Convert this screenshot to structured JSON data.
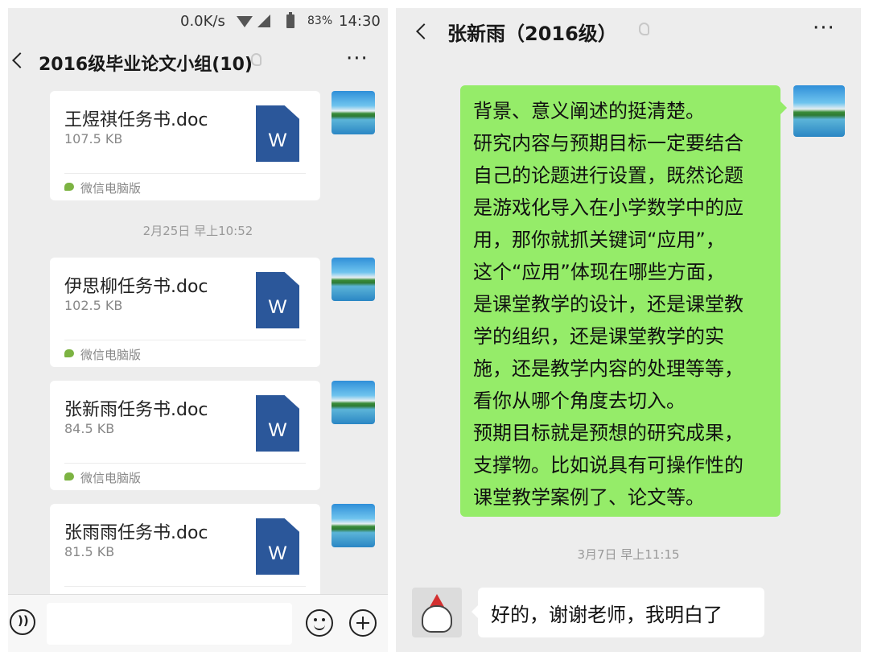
{
  "left": {
    "status_bar": {
      "net_speed": "0.0K/s",
      "battery_percent": "83%",
      "time": "14:30"
    },
    "chat_title": "2016级毕业论文小组(10)",
    "files": [
      {
        "name": "王煜祺任务书.doc",
        "size": "107.5 KB",
        "source": "微信电脑版"
      },
      {
        "name": "伊思柳任务书.doc",
        "size": "102.5 KB",
        "source": "微信电脑版"
      },
      {
        "name": "张新雨任务书.doc",
        "size": "84.5 KB",
        "source": "微信电脑版"
      },
      {
        "name": "张雨雨任务书.doc",
        "size": "81.5 KB"
      }
    ],
    "timestamp": "2月25日 早上10:52",
    "word_icon_letter": "W"
  },
  "right": {
    "chat_title": "张新雨（2016级）",
    "message_lines": [
      "背景、意义阐述的挺清楚。",
      "研究内容与预期目标一定要结合",
      "自己的论题进行设置，既然论题",
      "是游戏化导入在小学数学中的应",
      "用，那你就抓关键词“应用”，",
      "这个“应用”体现在哪些方面，",
      "是课堂教学的设计，还是课堂教",
      "学的组织，还是课堂教学的实",
      "施，还是教学内容的处理等等，",
      "看你从哪个角度去切入。",
      "预期目标就是预想的研究成果，",
      "支撑物。比如说具有可操作性的",
      "课堂教学案例了、论文等。"
    ],
    "timestamp": "3月7日 早上11:15",
    "reply": "好的，谢谢老师，我明白了"
  },
  "colors": {
    "sent_bubble": "#95ec69",
    "received_bubble": "#ffffff",
    "chat_background": "#ededed",
    "word_blue": "#2b579a"
  },
  "icons": [
    "back-icon",
    "ear-icon",
    "more-icon",
    "word-file-icon",
    "wechat-pc-icon",
    "voice-icon",
    "emoji-icon",
    "plus-icon"
  ]
}
